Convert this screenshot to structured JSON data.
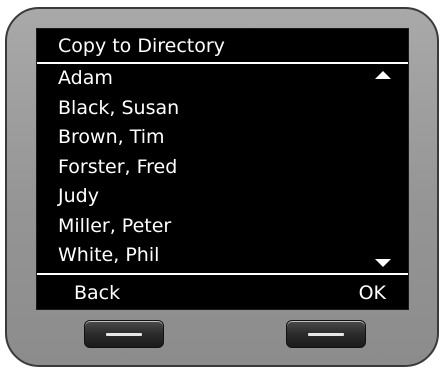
{
  "screen": {
    "title": "Copy to Directory",
    "entries": [
      {
        "name": "Adam"
      },
      {
        "name": "Black, Susan"
      },
      {
        "name": "Brown, Tim"
      },
      {
        "name": "Forster, Fred"
      },
      {
        "name": "Judy"
      },
      {
        "name": "Miller, Peter"
      },
      {
        "name": "White, Phil"
      }
    ],
    "softkeys": {
      "left": "Back",
      "right": "OK"
    }
  }
}
